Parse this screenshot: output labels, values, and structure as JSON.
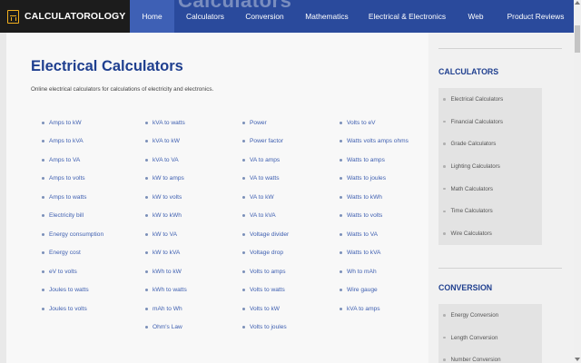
{
  "site": {
    "logo_text": "CALCULATOROLOGY",
    "watermark": "Calculators"
  },
  "nav": [
    {
      "label": "Home",
      "active": true
    },
    {
      "label": "Calculators"
    },
    {
      "label": "Conversion"
    },
    {
      "label": "Mathematics"
    },
    {
      "label": "Electrical & Electronics"
    },
    {
      "label": "Web"
    },
    {
      "label": "Product Reviews"
    }
  ],
  "main": {
    "title": "Electrical Calculators",
    "description": "Online electrical calculators for calculations of electricity and electronics.",
    "columns": [
      [
        "Amps to kW",
        "Amps to kVA",
        "Amps to VA",
        "Amps to volts",
        "Amps to watts",
        "Electricity bill",
        "Energy consumption",
        "Energy cost",
        "eV to volts",
        "Joules to watts",
        "Joules to volts"
      ],
      [
        "kVA to watts",
        "kVA to kW",
        "kVA to VA",
        "kW to amps",
        "kW to volts",
        "kW to kWh",
        "kW to VA",
        "kW to kVA",
        "kWh to kW",
        "kWh to watts",
        "mAh to Wh",
        "Ohm's Law"
      ],
      [
        "Power",
        "Power factor",
        "VA to amps",
        "VA to watts",
        "VA to kW",
        "VA to kVA",
        "Voltage divider",
        "Voltage drop",
        "Volts to amps",
        "Volts to watts",
        "Volts to kW",
        "Volts to joules"
      ],
      [
        "Volts to eV",
        "Watts volts amps ohms",
        "Watts to amps",
        "Watts to joules",
        "Watts to kWh",
        "Watts to volts",
        "Watts to VA",
        "Watts to kVA",
        "Wh to mAh",
        "Wire gauge",
        "kVA to amps"
      ]
    ]
  },
  "sidebar": {
    "calculators": {
      "title": "CALCULATORS",
      "items": [
        "Electrical Calculators",
        "Financial Calculators",
        "Grade Calculators",
        "Lighting Calculators",
        "Math Calculators",
        "Time Calculators",
        "Wire Calculators"
      ]
    },
    "conversion": {
      "title": "CONVERSION",
      "items": [
        "Energy Conversion",
        "Length Conversion",
        "Number Conversion"
      ]
    }
  },
  "colors": {
    "nav_bg": "#2a4a9c",
    "nav_active": "#3e60b5",
    "logo_bg": "#1c1c1c",
    "logo_accent": "#f2b01e",
    "title": "#1f3f8f",
    "link": "#3d5eb0"
  }
}
